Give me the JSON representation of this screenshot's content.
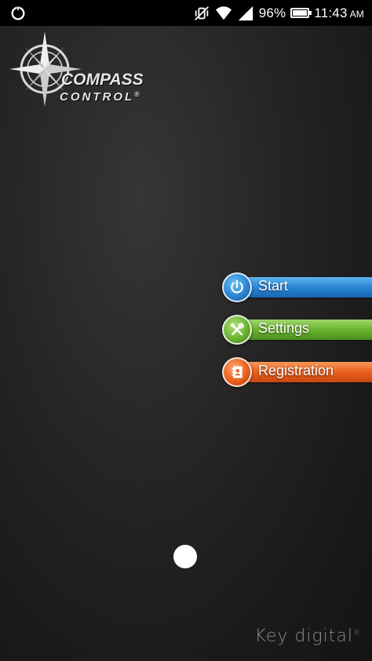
{
  "status_bar": {
    "battery": "96%",
    "battery_level": 0.96,
    "time": "11:43",
    "ampm": "AM",
    "icons": [
      "sync-icon",
      "vibrate-off-icon",
      "wifi-icon",
      "signal-icon",
      "battery-icon"
    ]
  },
  "logo": {
    "line1": "COMPASS",
    "line2": "CONTROL",
    "mark": "®"
  },
  "menu": {
    "items": [
      {
        "label": "Start",
        "icon": "power-icon",
        "color": "#2a86d4"
      },
      {
        "label": "Settings",
        "icon": "tools-icon",
        "color": "#6bb431"
      },
      {
        "label": "Registration",
        "icon": "contact-book-icon",
        "color": "#e9601c"
      }
    ]
  },
  "brand": {
    "text": "Key digital",
    "mark": "®"
  }
}
